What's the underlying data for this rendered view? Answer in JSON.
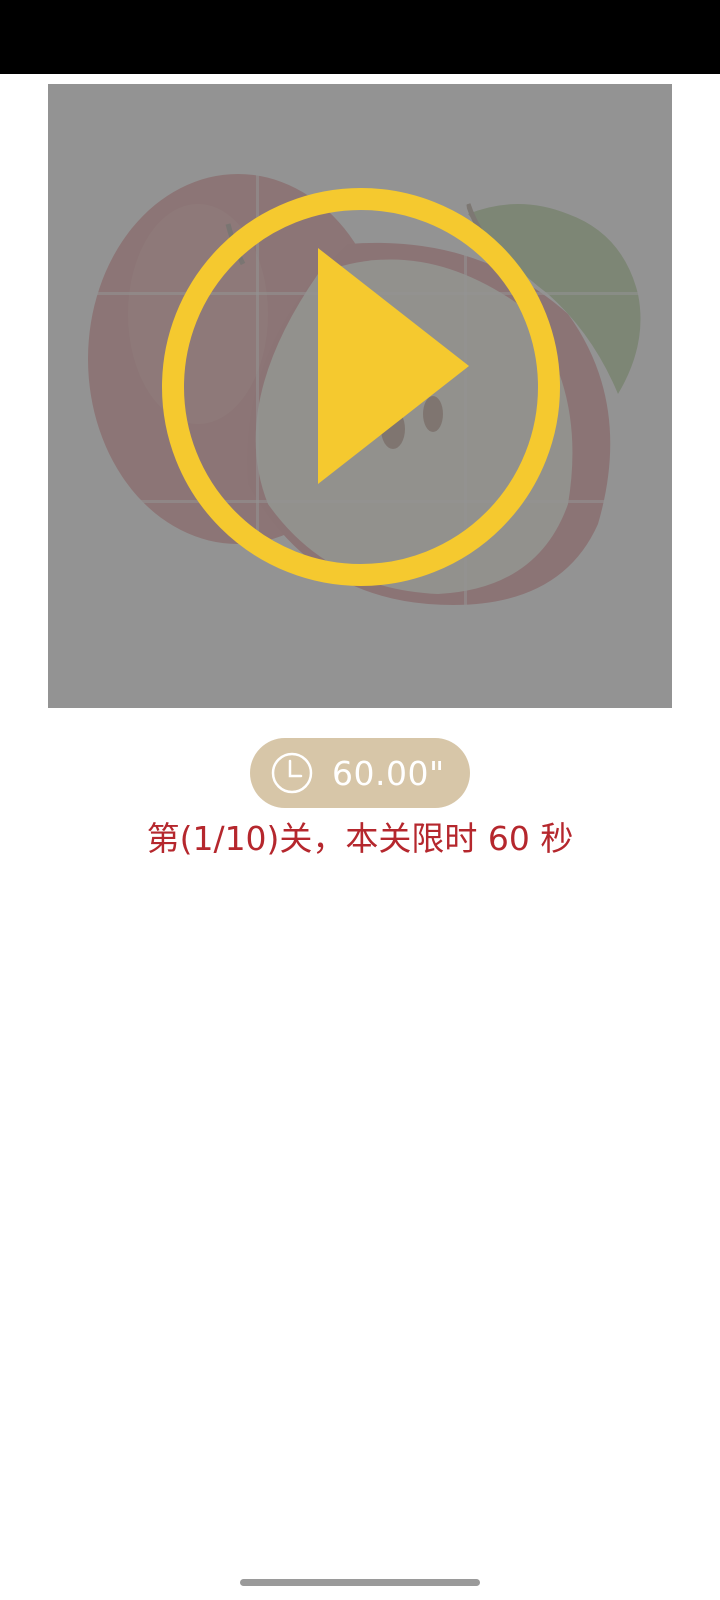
{
  "game": {
    "timer": "60.00\"",
    "level_info": "第(1/10)关，本关限时 60 秒"
  },
  "board": {
    "image_subject": "apple-icon",
    "grid_rows": 3,
    "grid_cols": 3,
    "state": "paused"
  },
  "colors": {
    "play_button": "#f5c92f",
    "timer_pill": "#d7c6a8",
    "level_text": "#b5272d",
    "overlay": "#8f8f8f"
  },
  "icons": {
    "play": "play-icon",
    "clock": "clock-icon"
  }
}
